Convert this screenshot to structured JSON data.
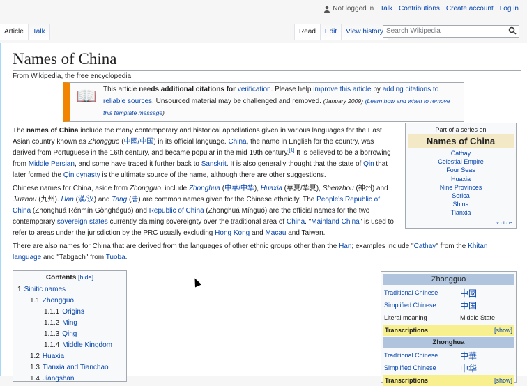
{
  "personal": {
    "user": "Not logged in",
    "talk": "Talk",
    "contributions": "Contributions",
    "create": "Create account",
    "login": "Log in"
  },
  "tabs": {
    "article": "Article",
    "talk": "Talk",
    "read": "Read",
    "edit": "Edit",
    "history": "View history"
  },
  "search": {
    "placeholder": "Search Wikipedia"
  },
  "page": {
    "title": "Names of China",
    "tagline": "From Wikipedia, the free encyclopedia"
  },
  "ambox": {
    "t1": "This article ",
    "t2": "needs additional citations for ",
    "l1": "verification",
    "t3": ". Please help ",
    "l2": "improve this article",
    "t4": " by ",
    "l3": "adding citations to",
    "l4": "reliable sources",
    "t5": ". Unsourced material may be challenged and removed. ",
    "date": "(January 2009)",
    "l5": "(Learn how and when to remove",
    "l6": "this template message",
    "t6": ")"
  },
  "para1": {
    "a": "The ",
    "b": "names of China",
    "c": " include the many contemporary and historical appellations given in various languages for the East Asian country known as ",
    "d": "Zhongguo",
    "e": " (",
    "f": "中國/中国",
    "g": ") in its official language. ",
    "h": "China",
    "i": ", the name in English for the country, was derived from Portuguese in the 16th century, and became popular in the mid 19th century.",
    "ref": "[1]",
    "j": " It is believed to be a borrowing from ",
    "k": "Middle Persian",
    "l": ", and some have traced it further back to ",
    "m": "Sanskrit",
    "n": ". It is also generally thought that the state of ",
    "o": "Qin",
    "p": " that later formed the ",
    "q": "Qin dynasty",
    "r": " is the ultimate source of the name, although there are other suggestions."
  },
  "para2": {
    "a": "Chinese names for China, aside from ",
    "b": "Zhongguo",
    "c": ", include ",
    "d": "Zhonghua",
    "e": " (",
    "f": "中華/中华",
    "g": "), ",
    "h": "Huaxia",
    "i": " (華夏/华夏), ",
    "j": "Shenzhou",
    "k": " (神州) and ",
    "l": "Jiuzhou",
    "m": " (九州). ",
    "n": "Han",
    "o": " (",
    "p": "漢/汉",
    "q": ") and ",
    "r": "Tang",
    "s": " (",
    "t": "唐",
    "u": ") are common names given for the Chinese ethnicity. The ",
    "v": "People's Republic of China",
    "w": " (Zhōnghuá Rénmín Gònghéguó) and ",
    "x": "Republic of China",
    "y": " (Zhōnghuá Mínguó) are the official names for the two contemporary ",
    "z": "sovereign states",
    "aa": " currently claiming sovereignty over the traditional area of ",
    "ab": "China",
    "ac": ". \"",
    "ad": "Mainland China",
    "ae": "\" is used to refer to areas under the jurisdiction by the PRC usually excluding ",
    "af": "Hong Kong",
    "ag": " and ",
    "ah": "Macau",
    "ai": " and Taiwan."
  },
  "para3": {
    "a": "There are also names for China that are derived from the languages of other ethnic groups other than the ",
    "b": "Han",
    "c": "; examples include \"",
    "d": "Cathay",
    "e": "\" from the ",
    "f": "Khitan language",
    "g": " and \"Tabgach\" from ",
    "h": "Tuoba",
    "i": "."
  },
  "sidebar": {
    "above": "Part of a series on",
    "title": "Names of China",
    "items": [
      "Cathay",
      "Celestial Empire",
      "Four Seas",
      "Huaxia",
      "Nine Provinces",
      "Serica",
      "Shina",
      "Tianxia"
    ],
    "vte": "v · t · e"
  },
  "toc": {
    "title": "Contents",
    "hide": "[hide]",
    "items": [
      {
        "num": "1",
        "label": "Sinitic names"
      },
      {
        "num": "1.1",
        "label": "Zhongguo"
      },
      {
        "num": "1.1.1",
        "label": "Origins"
      },
      {
        "num": "1.1.2",
        "label": "Ming"
      },
      {
        "num": "1.1.3",
        "label": "Qing"
      },
      {
        "num": "1.1.4",
        "label": "Middle Kingdom"
      },
      {
        "num": "1.2",
        "label": "Huaxia"
      },
      {
        "num": "1.3",
        "label": "Tianxia and Tianchao"
      },
      {
        "num": "1.4",
        "label": "Jiangshan"
      }
    ]
  },
  "infobox": {
    "title": "Zhongguo",
    "r1": {
      "label": "Traditional Chinese",
      "value": "中國"
    },
    "r2": {
      "label": "Simplified Chinese",
      "value": "中国"
    },
    "r3": {
      "label": "Literal meaning",
      "value": "Middle State"
    },
    "trans": "Transcriptions",
    "show": "[show]",
    "sub": "Zhonghua",
    "r4": {
      "label": "Traditional Chinese",
      "value": "中華"
    },
    "r5": {
      "label": "Simplified Chinese",
      "value": "中华"
    },
    "trans2": "Transcriptions",
    "show2": "[show]"
  }
}
